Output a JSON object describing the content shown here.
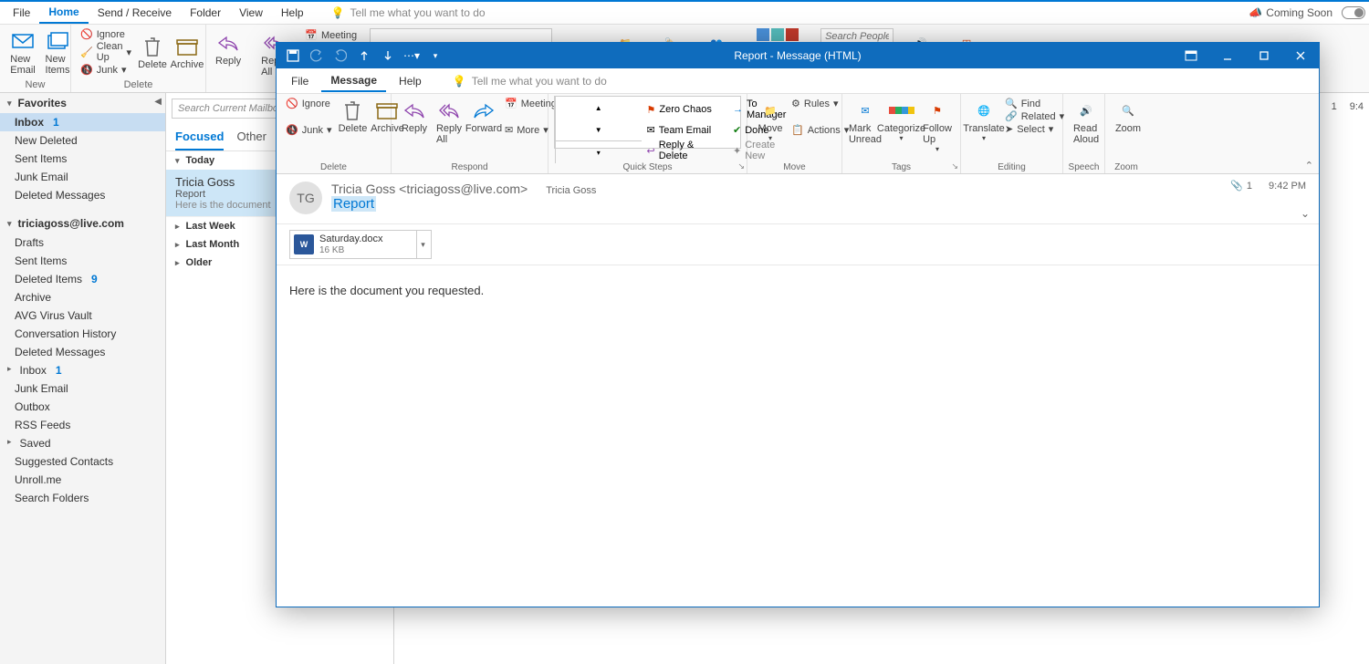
{
  "main": {
    "tabs": [
      "File",
      "Home",
      "Send / Receive",
      "Folder",
      "View",
      "Help"
    ],
    "active_tab": "Home",
    "tell_me": "Tell me what you want to do",
    "coming_soon": "Coming Soon",
    "search_people_placeholder": "Search People",
    "status_count": "1",
    "status_time": "9:4",
    "ribbon": {
      "new_email": "New\nEmail",
      "new_items": "New\nItems",
      "new_label": "New",
      "ignore": "Ignore",
      "clean_up": "Clean Up",
      "junk": "Junk",
      "delete": "Delete",
      "archive": "Archive",
      "delete_label": "Delete",
      "reply": "Reply",
      "reply_all": "Reply\nAll",
      "meeting": "Meeting",
      "zero_chaos": "Zero Chaos",
      "to_manager": "To Manager"
    }
  },
  "nav": {
    "favorites": "Favorites",
    "account": "triciagoss@live.com",
    "fav_items": [
      {
        "label": "Inbox",
        "count": "1",
        "sel": true
      },
      {
        "label": "New Deleted"
      },
      {
        "label": "Sent Items"
      },
      {
        "label": "Junk Email"
      },
      {
        "label": "Deleted Messages"
      }
    ],
    "acct_items": [
      {
        "label": "Drafts"
      },
      {
        "label": "Sent Items"
      },
      {
        "label": "Deleted Items",
        "count": "9"
      },
      {
        "label": "Archive"
      },
      {
        "label": "AVG Virus Vault"
      },
      {
        "label": "Conversation History"
      },
      {
        "label": "Deleted Messages"
      },
      {
        "label": "Inbox",
        "count": "1",
        "exp": true
      },
      {
        "label": "Junk Email"
      },
      {
        "label": "Outbox"
      },
      {
        "label": "RSS Feeds"
      },
      {
        "label": "Saved",
        "exp": true
      },
      {
        "label": "Suggested Contacts"
      },
      {
        "label": "Unroll.me"
      },
      {
        "label": "Search Folders"
      }
    ]
  },
  "list": {
    "search_placeholder": "Search Current Mailbo",
    "tabs": {
      "focused": "Focused",
      "other": "Other"
    },
    "groups": {
      "today": "Today",
      "last_week": "Last Week",
      "last_month": "Last Month",
      "older": "Older"
    },
    "message": {
      "from": "Tricia Goss",
      "subject": "Report",
      "preview": "Here is the document"
    }
  },
  "msgwin": {
    "title": "Report  -  Message (HTML)",
    "tabs": [
      "File",
      "Message",
      "Help"
    ],
    "active_tab": "Message",
    "tell_me": "Tell me what you want to do",
    "ribbon_groups": {
      "delete": {
        "ignore": "Ignore",
        "junk": "Junk",
        "delete": "Delete",
        "archive": "Archive",
        "label": "Delete"
      },
      "respond": {
        "reply": "Reply",
        "reply_all": "Reply\nAll",
        "forward": "Forward",
        "meeting": "Meeting",
        "more": "More",
        "label": "Respond"
      },
      "quick": {
        "zero": "Zero Chaos",
        "mgr": "To Manager",
        "team": "Team Email",
        "done": "Done",
        "rd": "Reply & Delete",
        "new": "Create New",
        "label": "Quick Steps"
      },
      "move": {
        "move": "Move",
        "rules": "Rules",
        "actions": "Actions",
        "label": "Move"
      },
      "tags": {
        "unread": "Mark\nUnread",
        "cat": "Categorize",
        "follow": "Follow\nUp",
        "label": "Tags"
      },
      "editing": {
        "translate": "Translate",
        "find": "Find",
        "related": "Related",
        "select": "Select",
        "label": "Editing"
      },
      "speech": {
        "read": "Read\nAloud",
        "label": "Speech"
      },
      "zoom": {
        "zoom": "Zoom",
        "label": "Zoom"
      }
    },
    "header": {
      "initials": "TG",
      "from": "Tricia Goss <triciagoss@live.com>",
      "to": "Tricia Goss",
      "subject": "Report",
      "attach_count": "1",
      "time": "9:42 PM"
    },
    "attachment": {
      "name": "Saturday.docx",
      "size": "16 KB"
    },
    "body": "Here is the document you requested."
  }
}
